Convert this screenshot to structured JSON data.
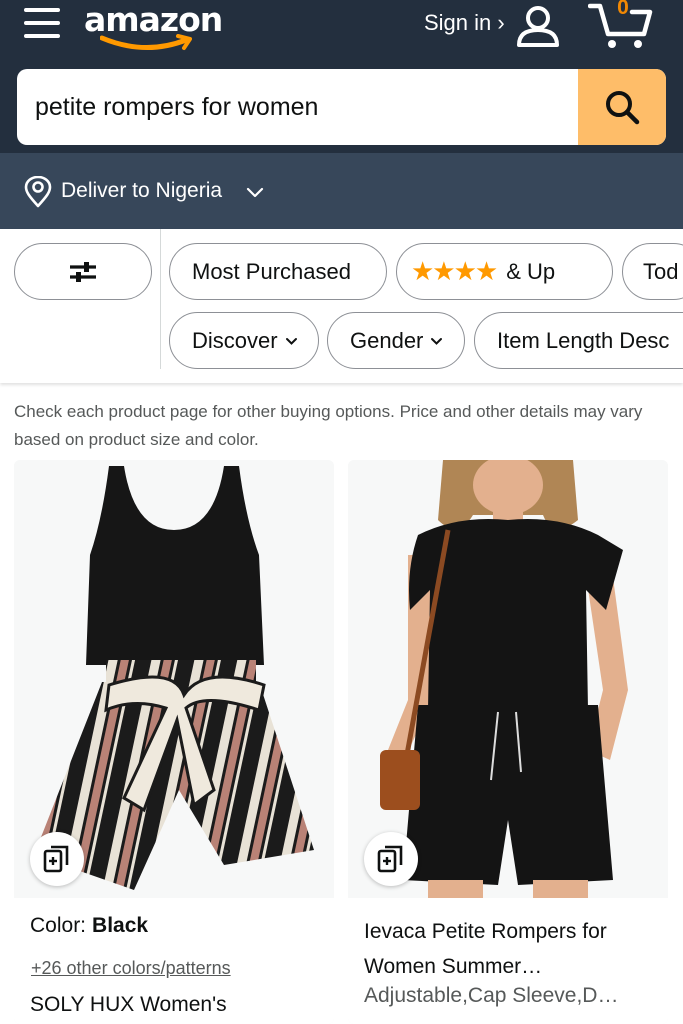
{
  "header": {
    "logo_text": "amazon",
    "sign_in": "Sign in ›",
    "cart_count": "0"
  },
  "search": {
    "value": "petite rompers for women"
  },
  "delivery": {
    "label": "Deliver to Nigeria"
  },
  "filters": {
    "row1": [
      {
        "label": "Most Purchased"
      },
      {
        "label": "& Up",
        "stars": "★★★★"
      },
      {
        "label": "Tod"
      }
    ],
    "row2": [
      {
        "label": "Discover"
      },
      {
        "label": "Gender"
      },
      {
        "label": "Item Length Desc"
      }
    ]
  },
  "notice": "Check each product page for other buying options. Price and other details may vary based on product size and color.",
  "products": [
    {
      "color_label": "Color:",
      "color_value": "Black",
      "colors_link": "+26 other colors/patterns",
      "title": "SOLY HUX Women's"
    },
    {
      "title": "Ievaca Petite Rompers for Women Summer…",
      "subtitle": "Adjustable,Cap Sleeve,D…"
    }
  ],
  "colors": {
    "header": "#232f3e",
    "deliver_bar": "#37475a",
    "search_button": "#febd69",
    "cart_count": "#f08804",
    "star": "#ff9900"
  },
  "icons": [
    "menu-icon",
    "amazon-smile-icon",
    "user-icon",
    "cart-icon",
    "search-icon",
    "location-pin-icon",
    "chevron-down-icon",
    "filter-sliders-icon",
    "compare-icon"
  ]
}
